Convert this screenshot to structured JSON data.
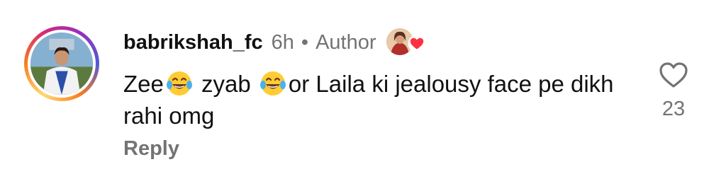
{
  "comment": {
    "username": "babrikshah_fc",
    "time": "6h",
    "separator": "•",
    "role_badge": "Author",
    "text_part1": "Zee",
    "text_part2": " zyab ",
    "text_part3": "or Laila ki jealousy face pe dikh rahi omg",
    "reply_label": "Reply",
    "like_count": "23"
  },
  "icons": {
    "emoji": "face-with-tears-of-joy-emoji",
    "like": "heart-outline-icon",
    "author_liked": "heart-filled-icon"
  },
  "colors": {
    "muted_text": "#737373",
    "heart_red": "#ff3040",
    "story_ring_start": "#feda75",
    "story_ring_end": "#d62976"
  }
}
